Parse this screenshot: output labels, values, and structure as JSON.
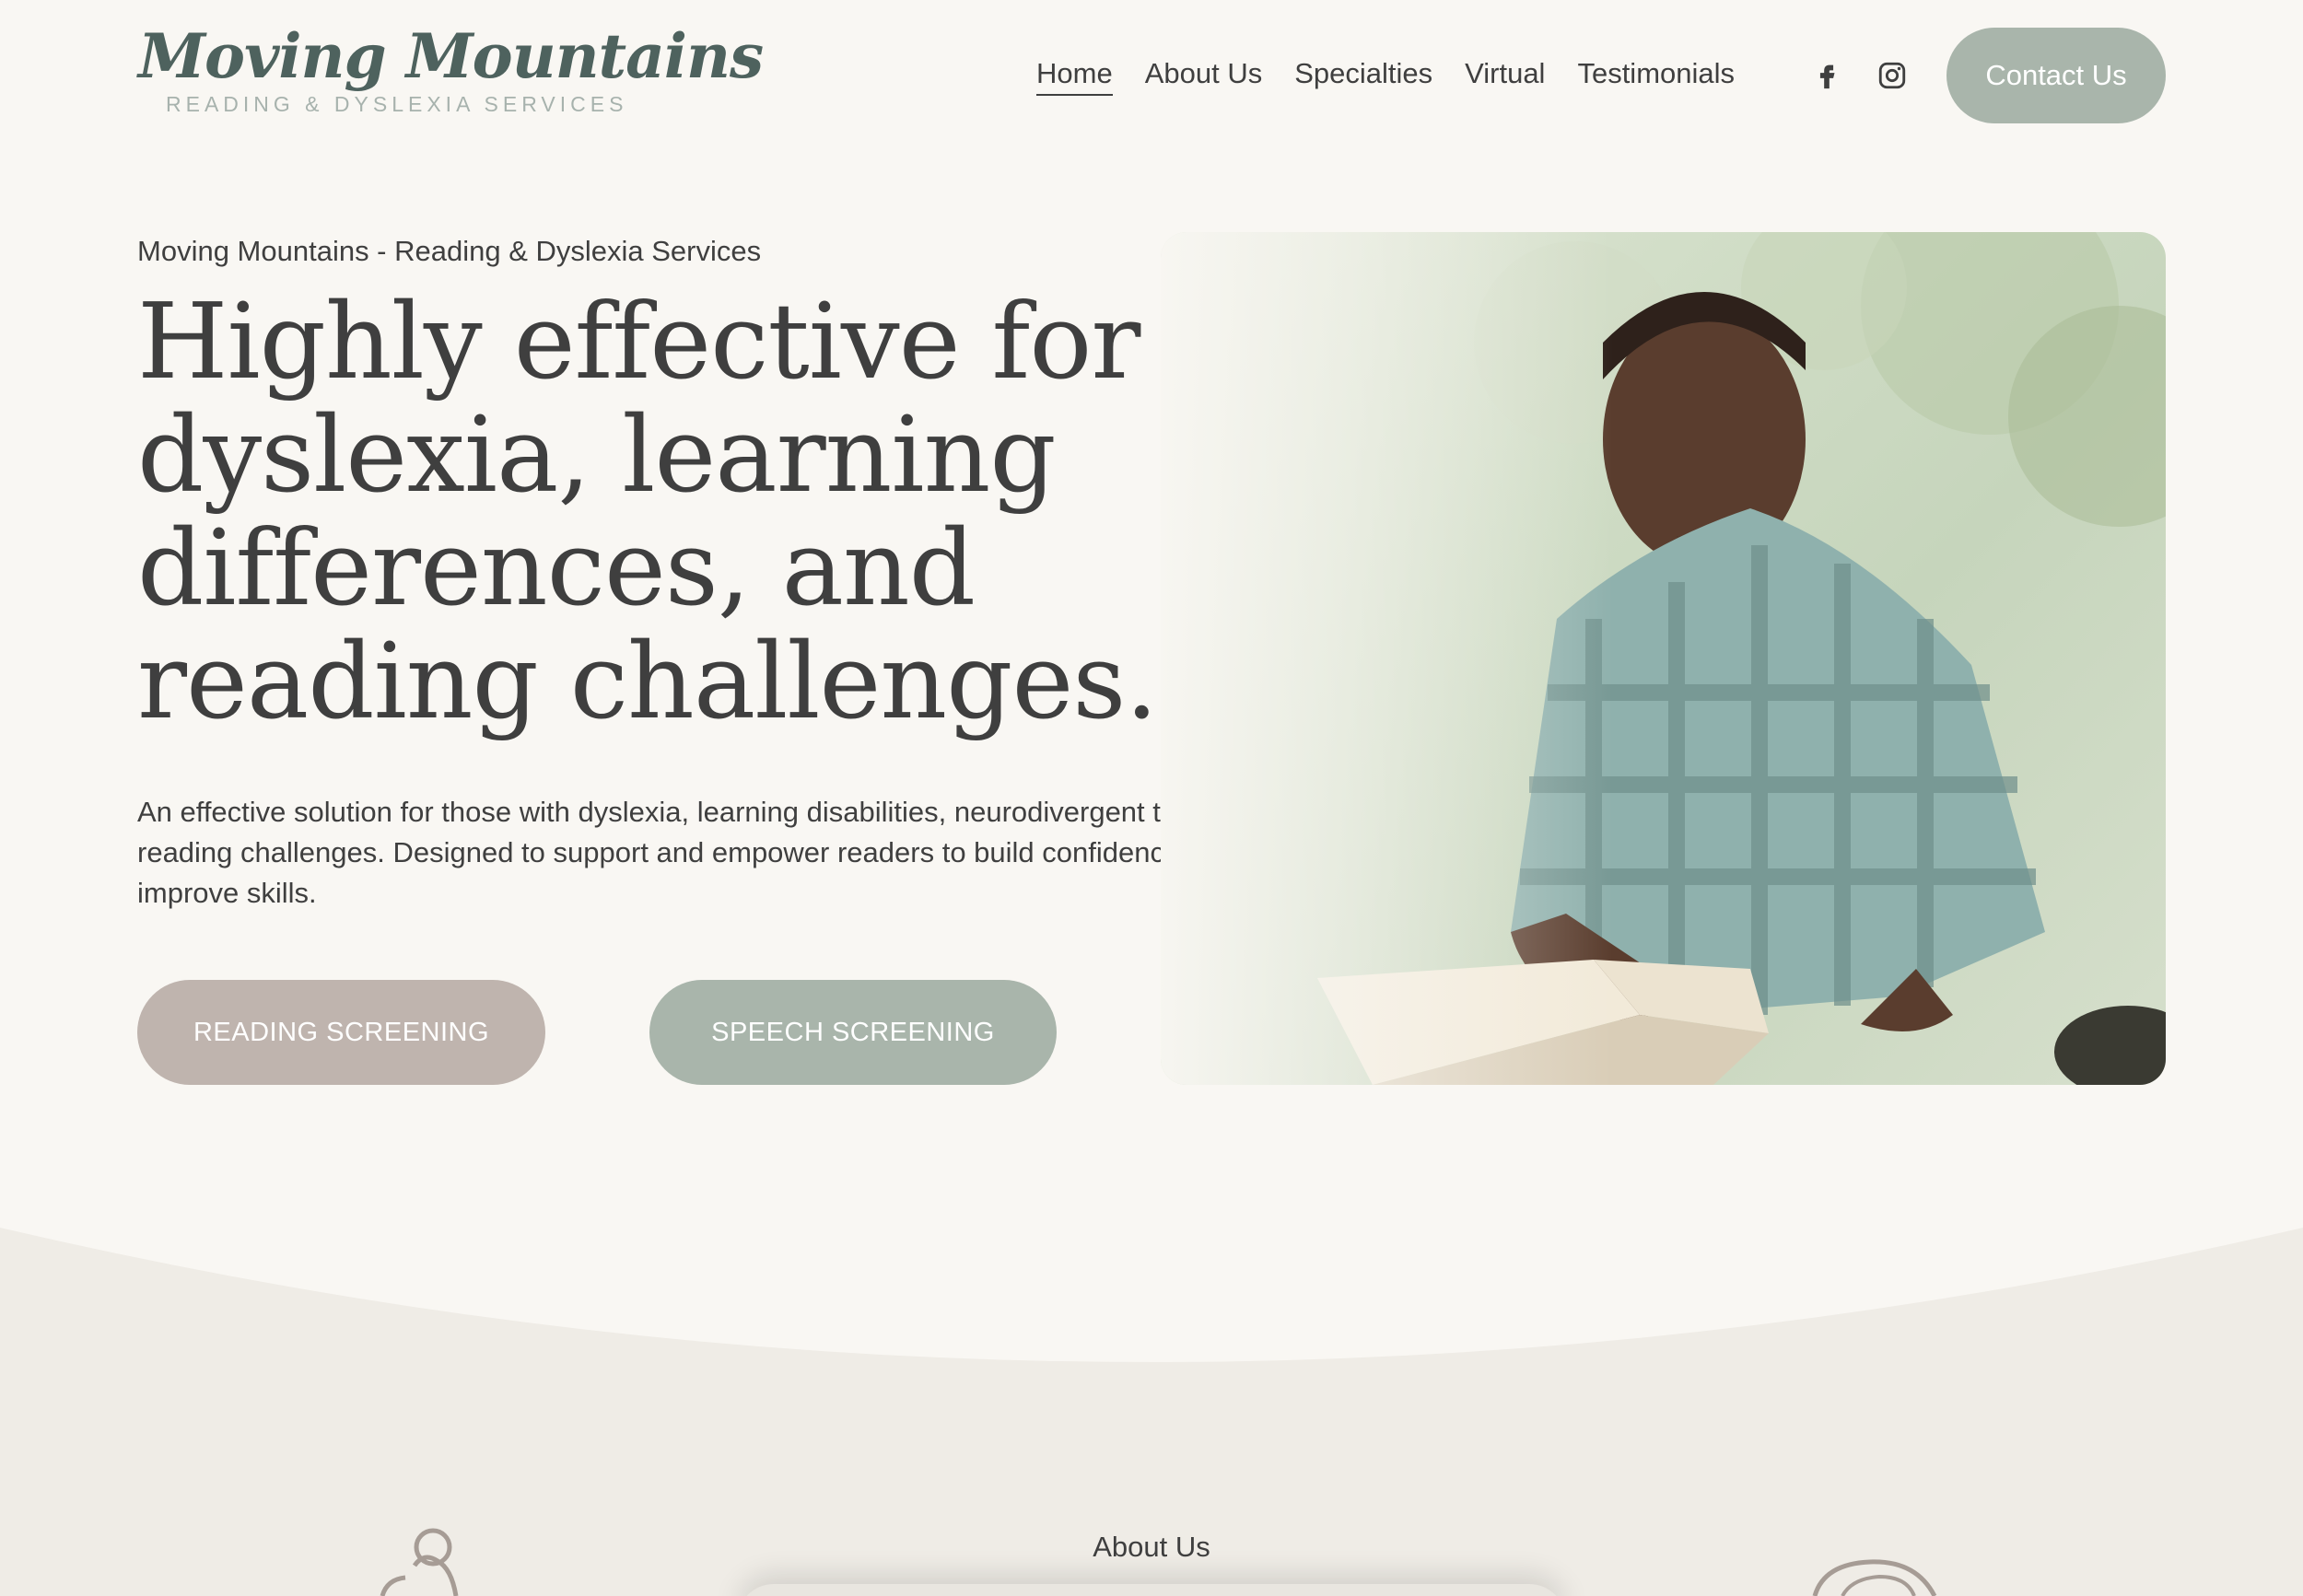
{
  "logo": {
    "script": "Moving Mountains",
    "subtitle": "READING & DYSLEXIA SERVICES"
  },
  "nav": {
    "items": [
      {
        "label": "Home",
        "active": true
      },
      {
        "label": "About Us",
        "active": false
      },
      {
        "label": "Specialties",
        "active": false
      },
      {
        "label": "Virtual",
        "active": false
      },
      {
        "label": "Testimonials",
        "active": false
      }
    ],
    "social": [
      "facebook-icon",
      "instagram-icon"
    ],
    "contact_label": "Contact Us"
  },
  "hero": {
    "eyebrow": "Moving Mountains - Reading & Dyslexia Services",
    "headline": "Highly effective for dyslexia, learning differences, and reading challenges.",
    "body": "An effective solution for those with dyslexia, learning disabilities, neurodivergent traits, or reading challenges. Designed to support and empower readers to build confidence and improve skills.",
    "buttons": {
      "reading": "READING SCREENING",
      "speech": "SPEECH SCREENING"
    }
  },
  "section2": {
    "label": "About Us"
  },
  "colors": {
    "background": "#f9f7f3",
    "section_bg": "#efece6",
    "accent_sage": "#a9b5ab",
    "accent_taupe": "#bfb4ae",
    "logo_green": "#4e625e",
    "text": "#3f3f3f"
  }
}
